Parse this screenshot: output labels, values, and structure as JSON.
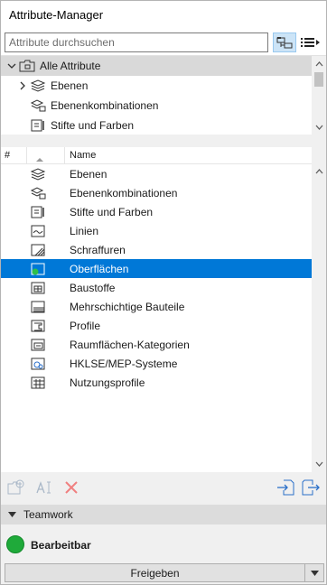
{
  "window": {
    "title": "Attribute-Manager"
  },
  "search": {
    "placeholder": "Attribute durchsuchen",
    "value": ""
  },
  "tree": {
    "root_label": "Alle Attribute",
    "items": [
      {
        "label": "Ebenen",
        "icon": "layers-icon"
      },
      {
        "label": "Ebenenkombinationen",
        "icon": "layer-combinations-icon"
      },
      {
        "label": "Stifte und Farben",
        "icon": "pens-colors-icon"
      }
    ]
  },
  "list": {
    "col_number": "#",
    "col_name": "Name",
    "rows": [
      {
        "label": "Ebenen",
        "icon": "layers-icon",
        "selected": false
      },
      {
        "label": "Ebenenkombinationen",
        "icon": "layer-combinations-icon",
        "selected": false
      },
      {
        "label": "Stifte und Farben",
        "icon": "pens-colors-icon",
        "selected": false
      },
      {
        "label": "Linien",
        "icon": "lines-icon",
        "selected": false
      },
      {
        "label": "Schraffuren",
        "icon": "fills-icon",
        "selected": false
      },
      {
        "label": "Oberflächen",
        "icon": "surfaces-icon",
        "selected": true
      },
      {
        "label": "Baustoffe",
        "icon": "building-materials-icon",
        "selected": false
      },
      {
        "label": "Mehrschichtige Bauteile",
        "icon": "composites-icon",
        "selected": false
      },
      {
        "label": "Profile",
        "icon": "profiles-icon",
        "selected": false
      },
      {
        "label": "Raumflächen-Kategorien",
        "icon": "zone-categories-icon",
        "selected": false
      },
      {
        "label": "HKLSE/MEP-Systeme",
        "icon": "mep-systems-icon",
        "selected": false
      },
      {
        "label": "Nutzungsprofile",
        "icon": "operation-profiles-icon",
        "selected": false
      }
    ]
  },
  "teamwork": {
    "header": "Teamwork",
    "status": "Bearbeitbar",
    "status_color": "#1faa3a",
    "release_button": "Freigeben"
  },
  "colors": {
    "selection": "#0078d7",
    "tree_root_bg": "#d9d9d9"
  }
}
